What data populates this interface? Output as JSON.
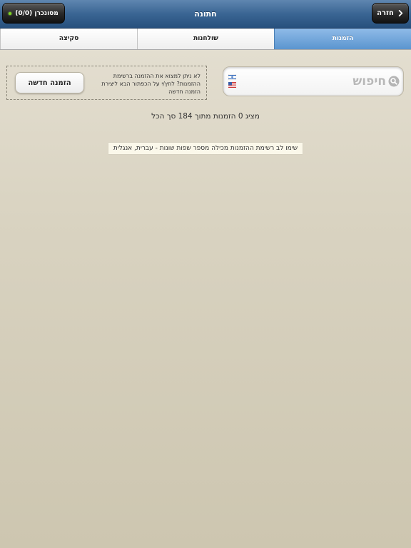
{
  "nav": {
    "title": "חתונה",
    "back_label": "חזרה",
    "sync_label": "מסונכרן (0/0)"
  },
  "tabs": [
    {
      "label": "הזמנות",
      "active": true
    },
    {
      "label": "שולחנות",
      "active": false
    },
    {
      "label": "סקיצה",
      "active": false
    }
  ],
  "search": {
    "placeholder": "חיפוש",
    "value": ""
  },
  "new_order": {
    "hint": "לא ניתן למצוא את ההזמנה ברשימת ההזמנות? לחץ/י על הכפתור הבא ליצירת הזמנה חדשה",
    "button_label": "הזמנה חדשה"
  },
  "status": {
    "count_text": "מציג 0 הזמנות מתוך 184 סך הכל",
    "note": "שימו לב רשימת ההזמנות מכילה מספר שפות שונות - עברית, אנגלית"
  },
  "colors": {
    "nav_bar": "#3a6593",
    "active_tab": "#5b95cf",
    "sync_indicator": "#7ed321",
    "background": "#d9d3c1"
  }
}
